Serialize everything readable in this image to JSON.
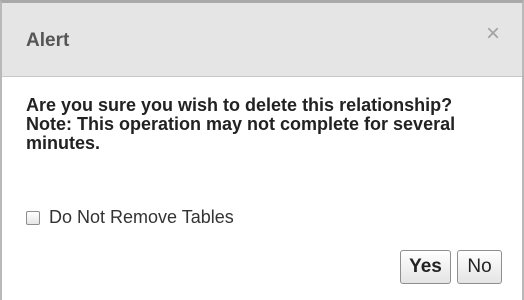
{
  "dialog": {
    "title": "Alert",
    "close_icon": "close-icon",
    "close_glyph": "×",
    "message": {
      "line1": "Are you sure you wish to delete this relationship?",
      "line2": "Note: This operation may not complete for several minutes."
    },
    "checkbox": {
      "label": "Do Not Remove Tables",
      "checked": false
    },
    "buttons": {
      "yes_label": "Yes",
      "no_label": "No"
    }
  }
}
